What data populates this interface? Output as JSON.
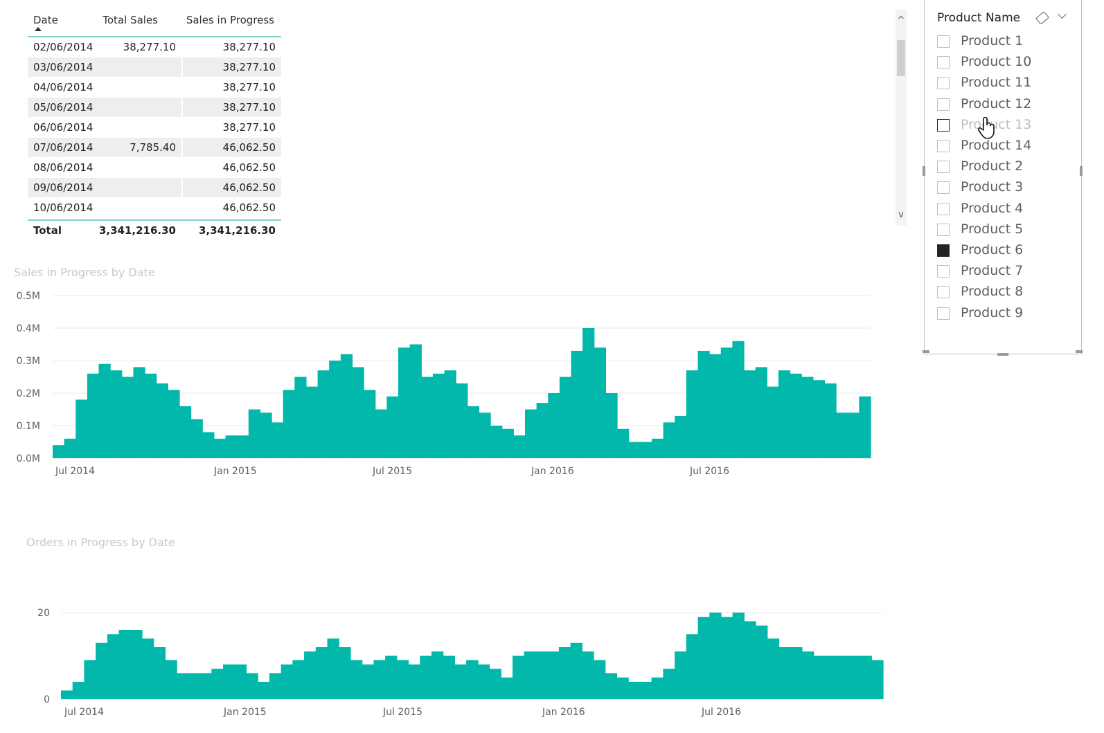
{
  "table": {
    "headers": {
      "date": "Date",
      "total_sales": "Total Sales",
      "sales_in_progress": "Sales in Progress"
    },
    "rows": [
      {
        "date": "02/06/2014",
        "total_sales": "38,277.10",
        "sales_in_progress": "38,277.10"
      },
      {
        "date": "03/06/2014",
        "total_sales": "",
        "sales_in_progress": "38,277.10"
      },
      {
        "date": "04/06/2014",
        "total_sales": "",
        "sales_in_progress": "38,277.10"
      },
      {
        "date": "05/06/2014",
        "total_sales": "",
        "sales_in_progress": "38,277.10"
      },
      {
        "date": "06/06/2014",
        "total_sales": "",
        "sales_in_progress": "38,277.10"
      },
      {
        "date": "07/06/2014",
        "total_sales": "7,785.40",
        "sales_in_progress": "46,062.50"
      },
      {
        "date": "08/06/2014",
        "total_sales": "",
        "sales_in_progress": "46,062.50"
      },
      {
        "date": "09/06/2014",
        "total_sales": "",
        "sales_in_progress": "46,062.50"
      },
      {
        "date": "10/06/2014",
        "total_sales": "",
        "sales_in_progress": "46,062.50"
      }
    ],
    "total": {
      "label": "Total",
      "total_sales": "3,341,216.30",
      "sales_in_progress": "3,341,216.30"
    },
    "scroll_up": "^",
    "scroll_down": "v"
  },
  "chart_data": [
    {
      "type": "area",
      "title": "Sales in Progress by Date",
      "ylim": [
        0,
        500000
      ],
      "y_ticks": [
        "0.0M",
        "0.1M",
        "0.2M",
        "0.3M",
        "0.4M",
        "0.5M"
      ],
      "x_ticks": [
        "Jul 2014",
        "Jan 2015",
        "Jul 2015",
        "Jan 2016",
        "Jul 2016"
      ],
      "color": "#01b8aa",
      "series": [
        {
          "values": [
            40000,
            60000,
            180000,
            260000,
            290000,
            270000,
            250000,
            280000,
            260000,
            230000,
            210000,
            160000,
            120000,
            80000,
            60000,
            70000,
            70000,
            150000,
            140000,
            110000,
            210000,
            250000,
            220000,
            270000,
            300000,
            320000,
            280000,
            210000,
            150000,
            190000,
            340000,
            350000,
            250000,
            260000,
            270000,
            230000,
            160000,
            140000,
            100000,
            90000,
            70000,
            150000,
            170000,
            200000,
            250000,
            330000,
            400000,
            340000,
            200000,
            90000,
            50000,
            50000,
            60000,
            110000,
            130000,
            270000,
            330000,
            320000,
            340000,
            360000,
            270000,
            280000,
            220000,
            270000,
            260000,
            250000,
            240000,
            230000,
            140000,
            140000,
            190000
          ]
        }
      ]
    },
    {
      "type": "area",
      "title": "Orders in Progress by Date",
      "ylim": [
        0,
        24
      ],
      "y_ticks": [
        "0",
        "20"
      ],
      "x_ticks": [
        "Jul 2014",
        "Jan 2015",
        "Jul 2015",
        "Jan 2016",
        "Jul 2016"
      ],
      "color": "#01b8aa",
      "series": [
        {
          "values": [
            2,
            4,
            9,
            13,
            15,
            16,
            16,
            14,
            12,
            9,
            6,
            6,
            6,
            7,
            8,
            8,
            6,
            4,
            6,
            8,
            9,
            11,
            12,
            14,
            12,
            9,
            8,
            9,
            10,
            9,
            8,
            10,
            11,
            10,
            8,
            9,
            8,
            7,
            5,
            10,
            11,
            11,
            11,
            12,
            13,
            11,
            9,
            6,
            5,
            4,
            4,
            5,
            7,
            11,
            15,
            19,
            20,
            19,
            20,
            18,
            17,
            14,
            12,
            12,
            11,
            10,
            10,
            10,
            10,
            10,
            9
          ]
        }
      ]
    }
  ],
  "slicer": {
    "header": "Product Name",
    "items": [
      {
        "label": "Product 1",
        "checked": false
      },
      {
        "label": "Product 10",
        "checked": false
      },
      {
        "label": "Product 11",
        "checked": false
      },
      {
        "label": "Product 12",
        "checked": false
      },
      {
        "label": "Product 13",
        "checked": false,
        "hover": true
      },
      {
        "label": "Product 14",
        "checked": false
      },
      {
        "label": "Product 2",
        "checked": false
      },
      {
        "label": "Product 3",
        "checked": false
      },
      {
        "label": "Product 4",
        "checked": false
      },
      {
        "label": "Product 5",
        "checked": false
      },
      {
        "label": "Product 6",
        "checked": true
      },
      {
        "label": "Product 7",
        "checked": false
      },
      {
        "label": "Product 8",
        "checked": false
      },
      {
        "label": "Product 9",
        "checked": false
      }
    ]
  },
  "icons": {
    "clear": "eraser-icon",
    "expand": "chevron-down-icon",
    "cursor": "hand-pointer-icon"
  }
}
